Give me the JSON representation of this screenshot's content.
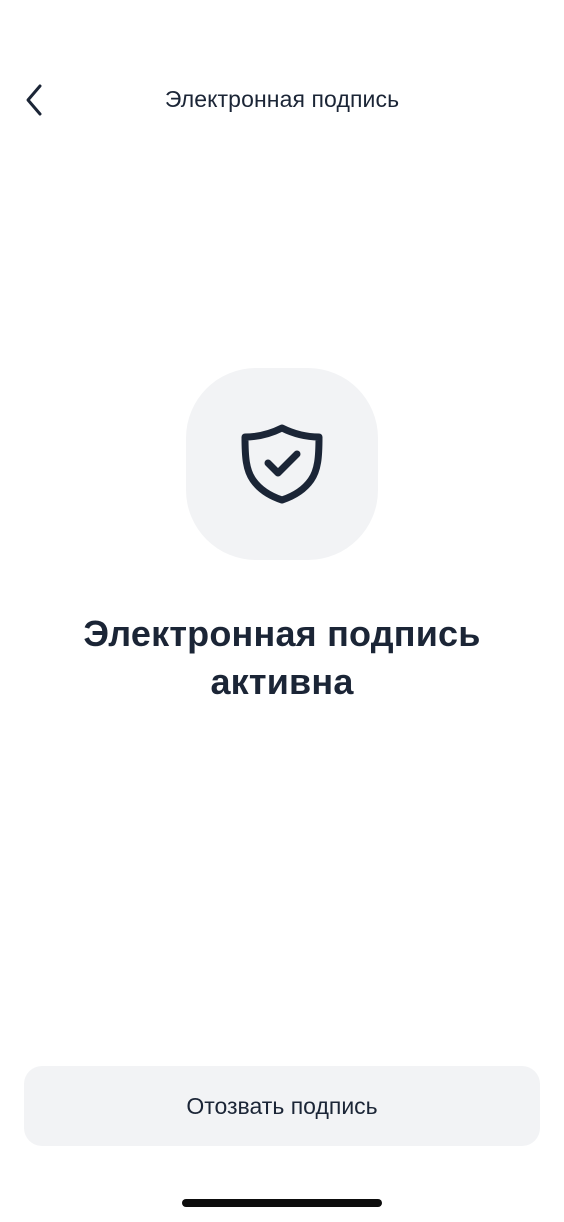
{
  "header": {
    "title": "Электронная подпись",
    "back_icon": "chevron-left-icon"
  },
  "main": {
    "icon": "shield-check-icon",
    "status_line1": "Электронная подпись",
    "status_line2": "активна"
  },
  "footer": {
    "revoke_label": "Отозвать подпись"
  },
  "colors": {
    "text": "#1b2536",
    "tile_bg": "#f2f3f5",
    "button_bg": "#f2f3f5",
    "background": "#ffffff"
  }
}
